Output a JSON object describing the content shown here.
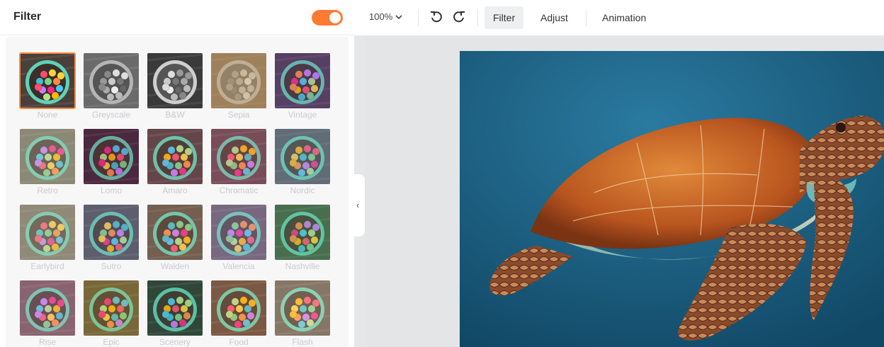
{
  "panel": {
    "title": "Filter",
    "toggle_on": true,
    "accent": "#ff7a33"
  },
  "toolbar": {
    "zoom": "100%",
    "undo_icon": "undo-icon",
    "redo_icon": "redo-icon",
    "tabs": [
      "Filter",
      "Adjust",
      "Animation"
    ],
    "active_tab": "Filter"
  },
  "filters": [
    {
      "label": "None",
      "tone": "orig",
      "selected": true
    },
    {
      "label": "Greyscale",
      "tone": "grey"
    },
    {
      "label": "B&W",
      "tone": "bw"
    },
    {
      "label": "Sepia",
      "tone": "sepia"
    },
    {
      "label": "Vintage",
      "tone": "vintage"
    },
    {
      "label": "Retro",
      "tone": "retro"
    },
    {
      "label": "Lomo",
      "tone": "lomo"
    },
    {
      "label": "Amaro",
      "tone": "amaro"
    },
    {
      "label": "Chromatic",
      "tone": "chromatic"
    },
    {
      "label": "Nordic",
      "tone": "nordic"
    },
    {
      "label": "Earlybird",
      "tone": "earlybird"
    },
    {
      "label": "Sutro",
      "tone": "sutro"
    },
    {
      "label": "Walden",
      "tone": "walden"
    },
    {
      "label": "Valencia",
      "tone": "valencia"
    },
    {
      "label": "Nashville",
      "tone": "nashville"
    },
    {
      "label": "Rise",
      "tone": "rise"
    },
    {
      "label": "Epic",
      "tone": "epic"
    },
    {
      "label": "Scenery",
      "tone": "scenery"
    },
    {
      "label": "Food",
      "tone": "food"
    },
    {
      "label": "Flash",
      "tone": "flash"
    }
  ],
  "colors": {
    "ocean": "#1a5a7c",
    "turtle_shell": "#c7692a",
    "bowl_rim": "#5fd3b6",
    "selected_border": "#ff8a3d"
  },
  "icons": {
    "collapse": "chevron-left-icon",
    "zoom_chevron": "chevron-down-icon"
  }
}
